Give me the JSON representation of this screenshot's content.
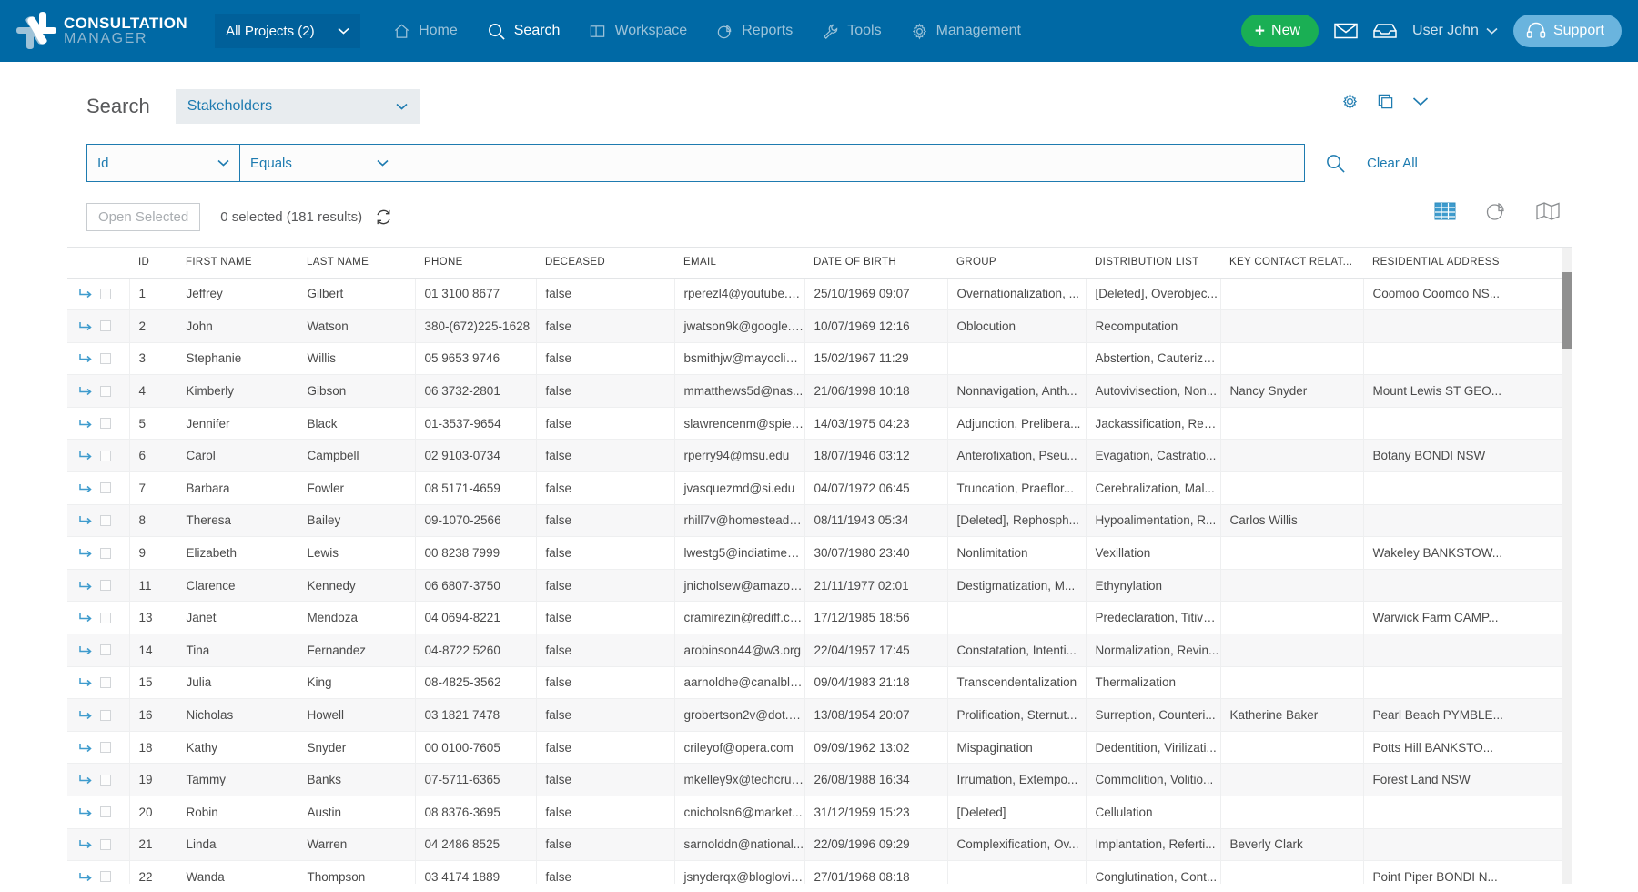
{
  "topnav": {
    "logo": {
      "line1": "CONSULTATION",
      "line2": "MANAGER"
    },
    "project_selector": {
      "label": "All Projects",
      "count": "(2)"
    },
    "links": [
      {
        "label": "Home",
        "icon": "home-icon",
        "active": false
      },
      {
        "label": "Search",
        "icon": "search-icon",
        "active": true
      },
      {
        "label": "Workspace",
        "icon": "workspace-icon",
        "active": false
      },
      {
        "label": "Reports",
        "icon": "reports-pie-icon",
        "active": false
      },
      {
        "label": "Tools",
        "icon": "wrench-icon",
        "active": false
      },
      {
        "label": "Management",
        "icon": "gear-icon",
        "active": false
      }
    ],
    "new_button": "New",
    "mail_icon": "envelope-icon",
    "inbox_icon": "inbox-tray-icon",
    "user": "User John",
    "support_button": "Support"
  },
  "search": {
    "title": "Search",
    "entity": "Stakeholders",
    "header_icons": [
      "gear-icon",
      "copy-icon",
      "chevron-down-icon"
    ],
    "filter": {
      "field": "Id",
      "operator": "Equals",
      "value": "",
      "placeholder": ""
    },
    "search_icon": "search-icon",
    "clear_all": "Clear All"
  },
  "actions": {
    "open_selected": "Open Selected",
    "selection_status": "0 selected (181 results)",
    "refresh_icon": "refresh-icon",
    "views": [
      {
        "name": "grid-view-icon",
        "active": true
      },
      {
        "name": "chart-view-icon",
        "active": false
      },
      {
        "name": "map-view-icon",
        "active": false
      }
    ]
  },
  "table": {
    "columns": [
      "",
      "ID",
      "FIRST NAME",
      "LAST NAME",
      "PHONE",
      "DECEASED",
      "EMAIL",
      "DATE OF BIRTH",
      "GROUP",
      "DISTRIBUTION LIST",
      "KEY CONTACT RELAT...",
      "RESIDENTIAL ADDRESS"
    ],
    "rows": [
      {
        "id": "1",
        "first": "Jeffrey",
        "last": "Gilbert",
        "phone": "01 3100 8677",
        "deceased": "false",
        "email": "rperezl4@youtube.c...",
        "dob": "25/10/1969 09:07",
        "group": "Overnationalization, ...",
        "dist": "[Deleted], Overobjec...",
        "key": "",
        "addr": "Coomoo Coomoo NS..."
      },
      {
        "id": "2",
        "first": "John",
        "last": "Watson",
        "phone": "380-(672)225-1628",
        "deceased": "false",
        "email": "jwatson9k@google.es",
        "dob": "10/07/1969 12:16",
        "group": "Oblocution",
        "dist": "Recomputation",
        "key": "",
        "addr": ""
      },
      {
        "id": "3",
        "first": "Stephanie",
        "last": "Willis",
        "phone": "05 9653 9746",
        "deceased": "false",
        "email": "bsmithjw@mayoclini...",
        "dob": "15/02/1967 11:29",
        "group": "",
        "dist": "Abstertion, Cauteriza...",
        "key": "",
        "addr": ""
      },
      {
        "id": "4",
        "first": "Kimberly",
        "last": "Gibson",
        "phone": "06 3732-2801",
        "deceased": "false",
        "email": "mmatthews5d@nas...",
        "dob": "21/06/1998 10:18",
        "group": "Nonnavigation, Anth...",
        "dist": "Autovivisection, Non...",
        "key": "Nancy Snyder",
        "addr": "Mount Lewis ST GEO..."
      },
      {
        "id": "5",
        "first": "Jennifer",
        "last": "Black",
        "phone": "01-3537-9654",
        "deceased": "false",
        "email": "slawrencenm@spieg...",
        "dob": "14/03/1975 04:23",
        "group": "Adjunction, Prelibera...",
        "dist": "Jackassification, Rea...",
        "key": "",
        "addr": ""
      },
      {
        "id": "6",
        "first": "Carol",
        "last": "Campbell",
        "phone": "02 9103-0734",
        "deceased": "false",
        "email": "rperry94@msu.edu",
        "dob": "18/07/1946 03:12",
        "group": "Anterofixation, Pseu...",
        "dist": "Evagation, Castratio...",
        "key": "",
        "addr": "Botany BONDI NSW"
      },
      {
        "id": "7",
        "first": "Barbara",
        "last": "Fowler",
        "phone": "08 5171-4659",
        "deceased": "false",
        "email": "jvasquezmd@si.edu",
        "dob": "04/07/1972 06:45",
        "group": "Truncation, Praeflor...",
        "dist": "Cerebralization, Mal...",
        "key": "",
        "addr": ""
      },
      {
        "id": "8",
        "first": "Theresa",
        "last": "Bailey",
        "phone": "09-1070-2566",
        "deceased": "false",
        "email": "rhill7v@homestead.c...",
        "dob": "08/11/1943 05:34",
        "group": "[Deleted], Rephosph...",
        "dist": "Hypoalimentation, R...",
        "key": "Carlos Willis",
        "addr": ""
      },
      {
        "id": "9",
        "first": "Elizabeth",
        "last": "Lewis",
        "phone": "00 8238 7999",
        "deceased": "false",
        "email": "lwestg5@indiatimes....",
        "dob": "30/07/1980 23:40",
        "group": "Nonlimitation",
        "dist": "Vexillation",
        "key": "",
        "addr": "Wakeley BANKSTOW..."
      },
      {
        "id": "11",
        "first": "Clarence",
        "last": "Kennedy",
        "phone": "06 6807-3750",
        "deceased": "false",
        "email": "jnicholsew@amazon....",
        "dob": "21/11/1977 02:01",
        "group": "Destigmatization, M...",
        "dist": "Ethynylation",
        "key": "",
        "addr": ""
      },
      {
        "id": "13",
        "first": "Janet",
        "last": "Mendoza",
        "phone": "04 0694-8221",
        "deceased": "false",
        "email": "cramirezin@rediff.co...",
        "dob": "17/12/1985 18:56",
        "group": "",
        "dist": "Predeclaration, Titiva...",
        "key": "",
        "addr": "Warwick Farm CAMP..."
      },
      {
        "id": "14",
        "first": "Tina",
        "last": "Fernandez",
        "phone": "04-8722 5260",
        "deceased": "false",
        "email": "arobinson44@w3.org",
        "dob": "22/04/1957 17:45",
        "group": "Constatation, Intenti...",
        "dist": "Normalization, Revin...",
        "key": "",
        "addr": ""
      },
      {
        "id": "15",
        "first": "Julia",
        "last": "King",
        "phone": "08-4825-3562",
        "deceased": "false",
        "email": "aarnoldhe@canalblo...",
        "dob": "09/04/1983 21:18",
        "group": "Transcendentalization",
        "dist": "Thermalization",
        "key": "",
        "addr": ""
      },
      {
        "id": "16",
        "first": "Nicholas",
        "last": "Howell",
        "phone": "03 1821 7478",
        "deceased": "false",
        "email": "grobertson2v@dot.g...",
        "dob": "13/08/1954 20:07",
        "group": "Prolification, Sternut...",
        "dist": "Surreption, Counteri...",
        "key": "Katherine Baker",
        "addr": "Pearl Beach PYMBLE..."
      },
      {
        "id": "18",
        "first": "Kathy",
        "last": "Snyder",
        "phone": "00 0100-7605",
        "deceased": "false",
        "email": "crileyof@opera.com",
        "dob": "09/09/1962 13:02",
        "group": "Mispagination",
        "dist": "Dedentition, Virilizati...",
        "key": "",
        "addr": "Potts Hill BANKSTO..."
      },
      {
        "id": "19",
        "first": "Tammy",
        "last": "Banks",
        "phone": "07-5711-6365",
        "deceased": "false",
        "email": "mkelley9x@techcrun...",
        "dob": "26/08/1988 16:34",
        "group": "Irrumation, Extempo...",
        "dist": "Commolition, Volitio...",
        "key": "",
        "addr": "Forest Land NSW"
      },
      {
        "id": "20",
        "first": "Robin",
        "last": "Austin",
        "phone": "08 8376-3695",
        "deceased": "false",
        "email": "cnicholsn6@market...",
        "dob": "31/12/1959 15:23",
        "group": "[Deleted]",
        "dist": "Cellulation",
        "key": "",
        "addr": ""
      },
      {
        "id": "21",
        "first": "Linda",
        "last": "Warren",
        "phone": "04 2486 8525",
        "deceased": "false",
        "email": "sarnolddn@national...",
        "dob": "22/09/1996 09:29",
        "group": "Complexification, Ov...",
        "dist": "Implantation, Referti...",
        "key": "Beverly Clark",
        "addr": ""
      },
      {
        "id": "22",
        "first": "Wanda",
        "last": "Thompson",
        "phone": "03 4174 1889",
        "deceased": "false",
        "email": "jsnyderqx@bloglovin...",
        "dob": "27/01/1968 08:18",
        "group": "",
        "dist": "Conglutination, Cont...",
        "key": "",
        "addr": "Point Piper BONDI N..."
      }
    ]
  },
  "colors": {
    "nav_blue": "#0069a5",
    "accent_blue": "#1e7bb0",
    "new_green": "#1aaf54",
    "support_blue": "#6ab4de"
  }
}
